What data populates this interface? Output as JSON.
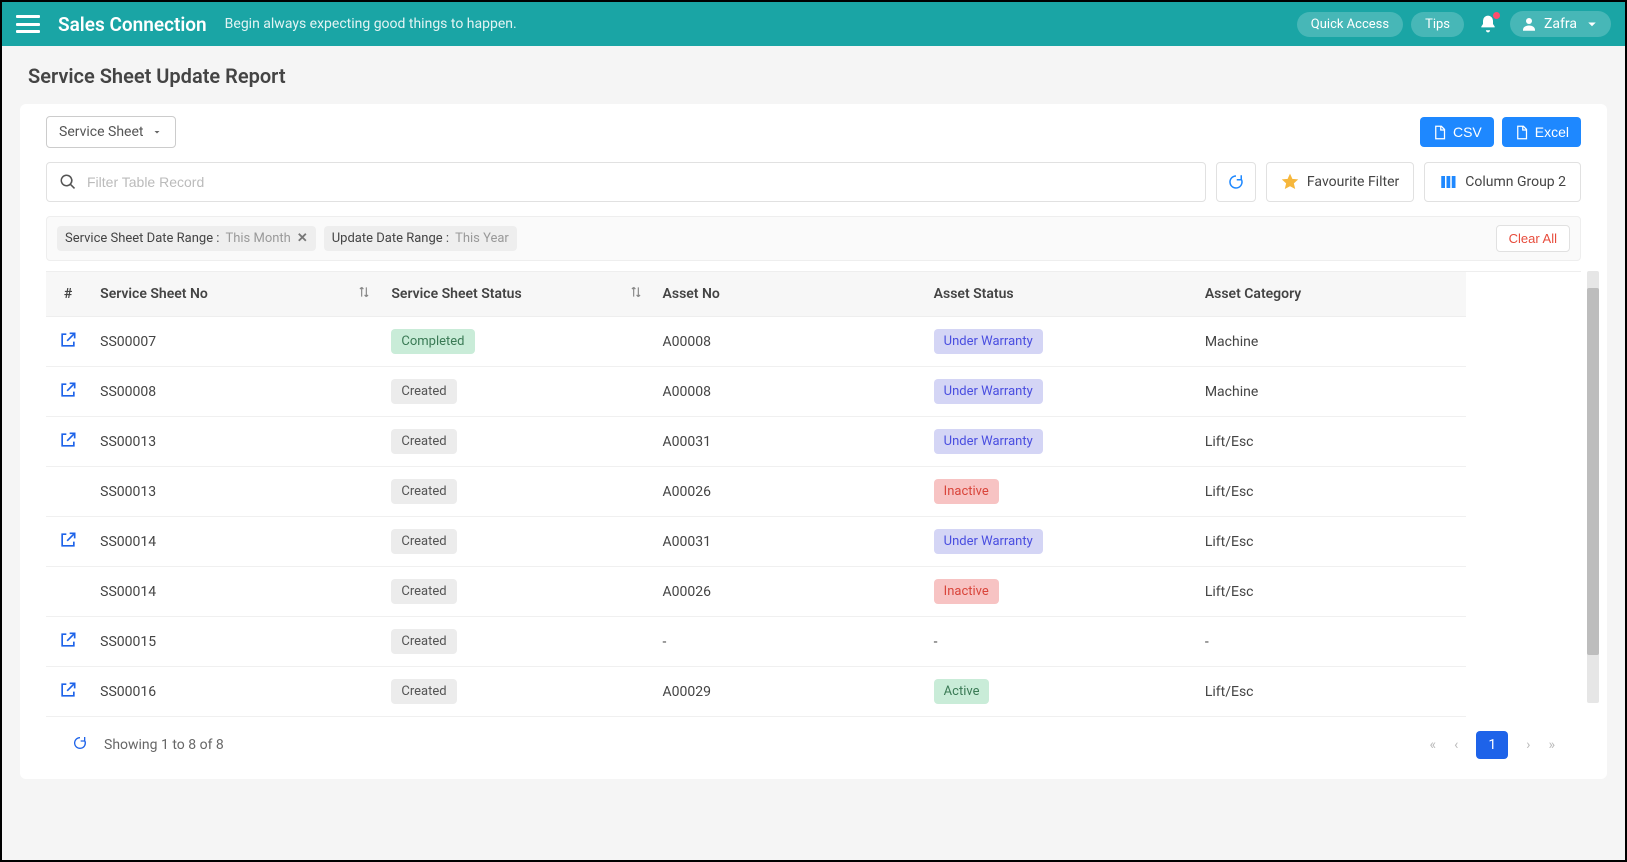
{
  "header": {
    "brand": "Sales Connection",
    "tagline": "Begin always expecting good things to happen.",
    "quick_access": "Quick Access",
    "tips": "Tips",
    "user": "Zafra"
  },
  "page": {
    "title": "Service Sheet Update Report",
    "dropdown": "Service Sheet",
    "csv": "CSV",
    "excel": "Excel",
    "search_placeholder": "Filter Table Record",
    "fav_filter": "Favourite Filter",
    "col_group": "Column Group 2",
    "clear_all": "Clear All"
  },
  "chips": [
    {
      "label": "Service Sheet Date Range",
      "value": "This Month",
      "closable": true
    },
    {
      "label": "Update Date Range",
      "value": "This Year",
      "closable": false
    }
  ],
  "columns": {
    "hash": "#",
    "no": "Service Sheet No",
    "status": "Service Sheet Status",
    "asset": "Asset No",
    "astatus": "Asset Status",
    "cat": "Asset Category"
  },
  "rows": [
    {
      "open": true,
      "no": "SS00007",
      "status": "Completed",
      "status_class": "b-completed",
      "asset": "A00008",
      "astatus": "Under Warranty",
      "astatus_class": "b-warranty",
      "cat": "Machine"
    },
    {
      "open": true,
      "no": "SS00008",
      "status": "Created",
      "status_class": "b-created",
      "asset": "A00008",
      "astatus": "Under Warranty",
      "astatus_class": "b-warranty",
      "cat": "Machine"
    },
    {
      "open": true,
      "no": "SS00013",
      "status": "Created",
      "status_class": "b-created",
      "asset": "A00031",
      "astatus": "Under Warranty",
      "astatus_class": "b-warranty",
      "cat": "Lift/Esc"
    },
    {
      "open": false,
      "no": "SS00013",
      "status": "Created",
      "status_class": "b-created",
      "asset": "A00026",
      "astatus": "Inactive",
      "astatus_class": "b-inactive",
      "cat": "Lift/Esc"
    },
    {
      "open": true,
      "no": "SS00014",
      "status": "Created",
      "status_class": "b-created",
      "asset": "A00031",
      "astatus": "Under Warranty",
      "astatus_class": "b-warranty",
      "cat": "Lift/Esc"
    },
    {
      "open": false,
      "no": "SS00014",
      "status": "Created",
      "status_class": "b-created",
      "asset": "A00026",
      "astatus": "Inactive",
      "astatus_class": "b-inactive",
      "cat": "Lift/Esc"
    },
    {
      "open": true,
      "no": "SS00015",
      "status": "Created",
      "status_class": "b-created",
      "asset": "-",
      "astatus": "-",
      "astatus_class": "",
      "cat": "-"
    },
    {
      "open": true,
      "no": "SS00016",
      "status": "Created",
      "status_class": "b-created",
      "asset": "A00029",
      "astatus": "Active",
      "astatus_class": "b-active",
      "cat": "Lift/Esc"
    }
  ],
  "footer": {
    "showing": "Showing 1 to 8 of 8",
    "page": "1"
  }
}
